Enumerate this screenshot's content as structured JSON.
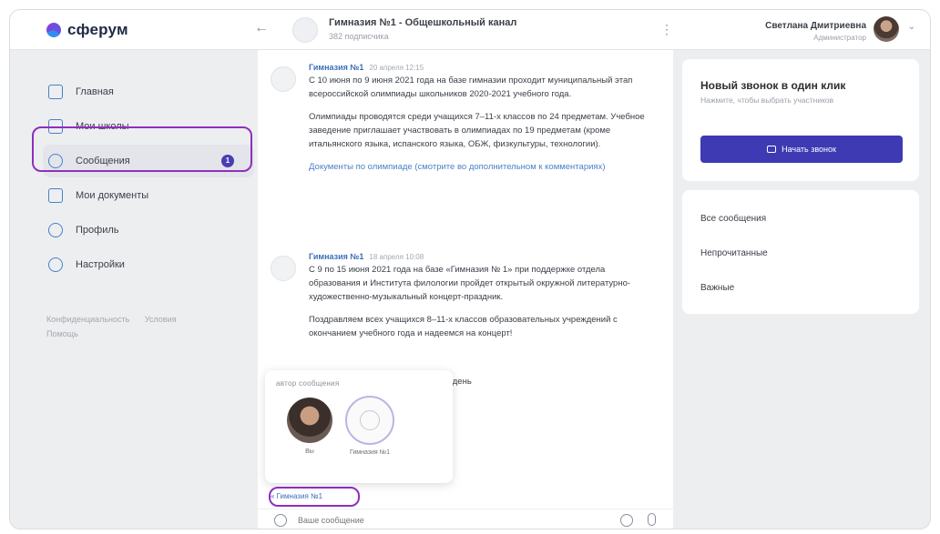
{
  "header": {
    "logo_text": "сферум",
    "chat_title": "Гимназия №1 - Общешкольный канал",
    "chat_subtitle": "382 подписчика",
    "user_name": "Светлана Дмитриевна",
    "user_role": "Администратор"
  },
  "sidebar": {
    "items": [
      {
        "label": "Главная",
        "icon": "home-icon"
      },
      {
        "label": "Мои школы",
        "icon": "school-icon"
      },
      {
        "label": "Сообщения",
        "icon": "chat-bubble-icon",
        "badge": "1"
      },
      {
        "label": "Мои документы",
        "icon": "document-icon"
      },
      {
        "label": "Профиль",
        "icon": "profile-icon"
      },
      {
        "label": "Настройки",
        "icon": "settings-icon"
      }
    ],
    "footer": [
      "Конфиденциальность",
      "Условия",
      "Помощь"
    ]
  },
  "messages": [
    {
      "author": "Гимназия №1",
      "time": "20 апреля 12:15",
      "paragraphs": [
        "С 10 июня по 9 июня 2021 года на базе гимназии проходит муниципальный этап всероссийской олимпиады школьников 2020-2021 учебного года.",
        "Олимпиады проводятся среди учащихся 7–11-х классов по 24 предметам. Учебное заведение приглашает участвовать в олимпиадах по 19 предметам (кроме итальянского языка, испанского языка, ОБЖ, физкультуры, технологии)."
      ],
      "link": "Документы по олимпиаде (смотрите во дополнительном к комментариях)"
    },
    {
      "author": "Гимназия №1",
      "time": "18 апреля 10:08",
      "paragraphs": [
        "С 9 по 15 июня 2021 года на базе «Гимназия № 1» при поддержке отдела образования и Института филологии пройдет открытый окружной литературно-художественно-музыкальный концерт-праздник.",
        "Поздравляем всех учащихся 8–11-х классов образовательных учреждений с окончанием учебного года и надеемся на концерт!"
      ]
    }
  ],
  "popover": {
    "title": "автор сообщения",
    "you_label": "Вы",
    "channel_label": "Гимназия №1"
  },
  "partial_text": "— выходной день",
  "reply_chip": "« Гимназия №1",
  "composer": {
    "placeholder": "Ваше сообщение"
  },
  "right_panel": {
    "call_title": "Новый звонок в один клик",
    "call_subtitle": "Нажмите, чтобы выбрать участников",
    "call_button": "Начать звонок",
    "filters": [
      "Все сообщения",
      "Непрочитанные",
      "Важные"
    ]
  },
  "colors": {
    "accent": "#3d3ab3",
    "highlight": "#8e2fbf",
    "link": "#3b6fb8"
  }
}
